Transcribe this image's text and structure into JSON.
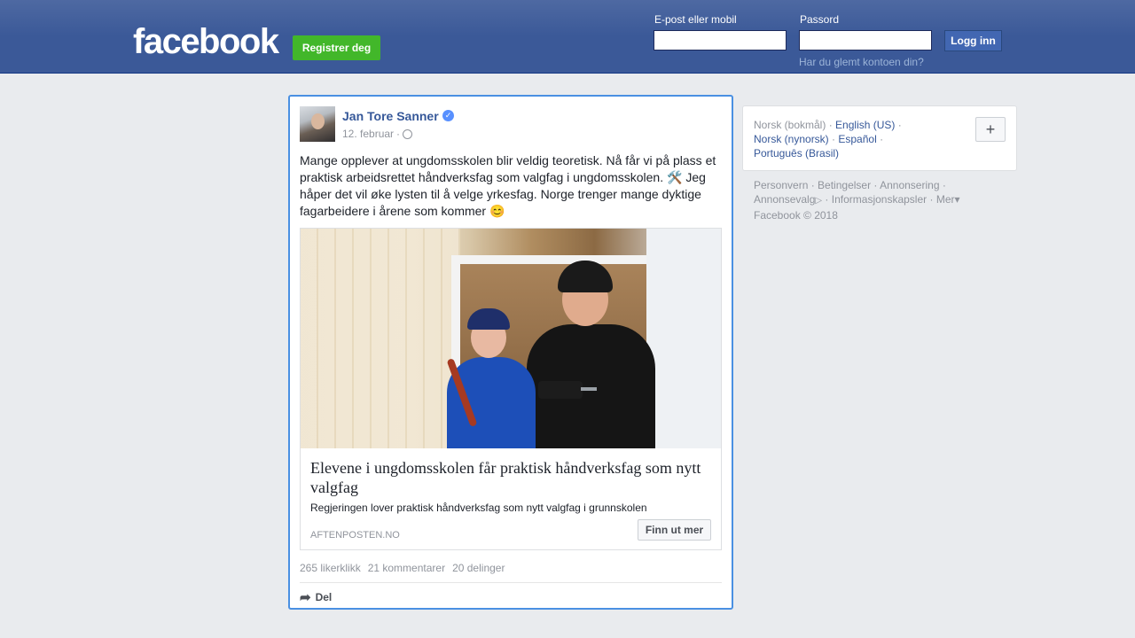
{
  "header": {
    "logo": "facebook",
    "register_label": "Registrer deg",
    "email_label": "E-post eller mobil",
    "password_label": "Passord",
    "login_label": "Logg inn",
    "forgot_label": "Har du glemt kontoen din?"
  },
  "post": {
    "author": "Jan Tore Sanner",
    "date": "12. februar",
    "separator": "·",
    "text": "Mange opplever at ungdomsskolen blir veldig teoretisk. Nå får vi på plass et praktisk arbeidsrettet håndverksfag som valgfag i ungdomsskolen. 🛠️ Jeg håper det vil øke lysten til å velge yrkesfag. Norge trenger mange dyktige fagarbeidere i årene som kommer 😊",
    "link": {
      "title": "Elevene i ungdomsskolen får praktisk håndverksfag som nytt valgfag",
      "description": "Regjeringen lover praktisk håndverksfag som nytt valgfag i grunnskolen",
      "source": "AFTENPOSTEN.NO",
      "button_label": "Finn ut mer"
    },
    "stats": {
      "likes": "265 likerklikk",
      "comments": "21 kommentarer",
      "shares": "20 delinger"
    },
    "share_label": "Del"
  },
  "languages": {
    "current": "Norsk (bokmål)",
    "english": "English (US)",
    "nynorsk": "Norsk (nynorsk)",
    "spanish": "Español",
    "portuguese": "Português (Brasil)",
    "sep": "·"
  },
  "footer": {
    "privacy": "Personvern",
    "terms": "Betingelser",
    "advertising": "Annonsering",
    "ad_choices": "Annonsevalg",
    "cookies": "Informasjonskapsler",
    "more": "Mer",
    "copyright": "Facebook © 2018"
  },
  "colors": {
    "brand": "#3b5998",
    "link": "#365899",
    "register": "#42b72a",
    "focus_border": "#4a90e2"
  }
}
